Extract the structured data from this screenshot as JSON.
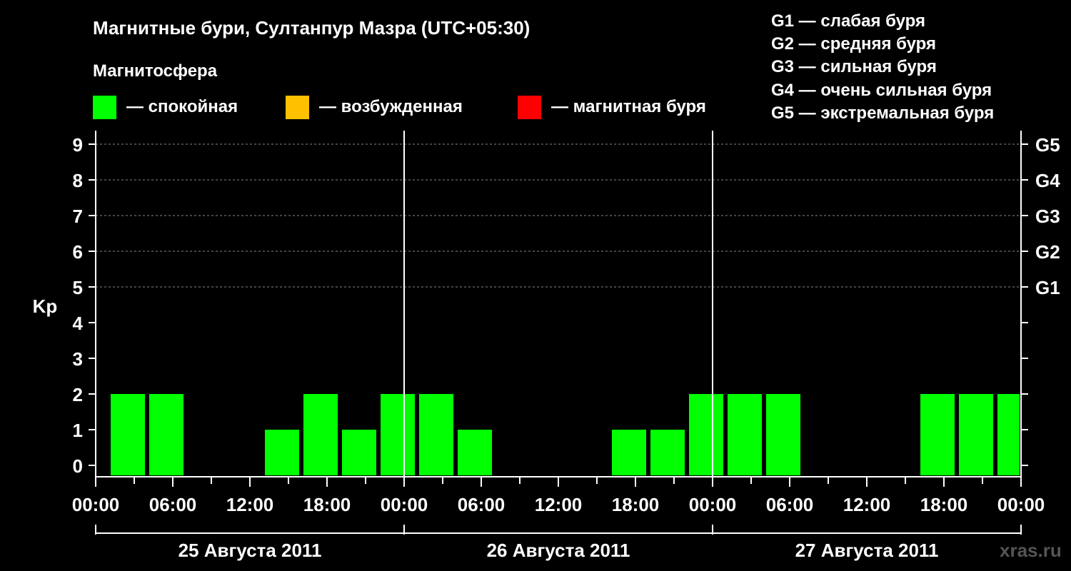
{
  "title": "Магнитные бури, Султанпур Мазра (UTC+05:30)",
  "subtitle": "Магнитосфера",
  "legend": [
    {
      "label": "— спокойная",
      "color": "#00ff00"
    },
    {
      "label": "— возбужденная",
      "color": "#ffc000"
    },
    {
      "label": "— магнитная буря",
      "color": "#ff0000"
    }
  ],
  "g_legend": [
    "G1 — слабая буря",
    "G2 — средняя буря",
    "G3 — сильная буря",
    "G4 — очень сильная буря",
    "G5 — экстремальная буря"
  ],
  "watermark": "xras.ru",
  "chart_data": {
    "type": "bar",
    "ylabel": "Kp",
    "ylim": [
      0,
      9
    ],
    "y_ticks": [
      "0",
      "1",
      "2",
      "3",
      "4",
      "5",
      "6",
      "7",
      "8",
      "9"
    ],
    "right_ticks": [
      {
        "kp": 5,
        "label": "G1"
      },
      {
        "kp": 6,
        "label": "G2"
      },
      {
        "kp": 7,
        "label": "G3"
      },
      {
        "kp": 8,
        "label": "G4"
      },
      {
        "kp": 9,
        "label": "G5"
      }
    ],
    "x_tick_labels": [
      "00:00",
      "06:00",
      "12:00",
      "18:00",
      "00:00",
      "06:00",
      "12:00",
      "18:00",
      "00:00",
      "06:00",
      "12:00",
      "18:00",
      "00:00"
    ],
    "days": [
      "25 Августа 2011",
      "26 Августа 2011",
      "27 Августа 2011"
    ],
    "bar_start_time": "25 Августа 2011 02:30",
    "bar_interval_hours": 3,
    "values": [
      2,
      2,
      0,
      0,
      1,
      2,
      1,
      2,
      2,
      1,
      0,
      0,
      0,
      1,
      1,
      2,
      2,
      2,
      0,
      0,
      0,
      2,
      2,
      2
    ],
    "colors": {
      "quiet": "#00ff00",
      "active": "#ffc000",
      "storm": "#ff0000"
    },
    "grid": true
  }
}
